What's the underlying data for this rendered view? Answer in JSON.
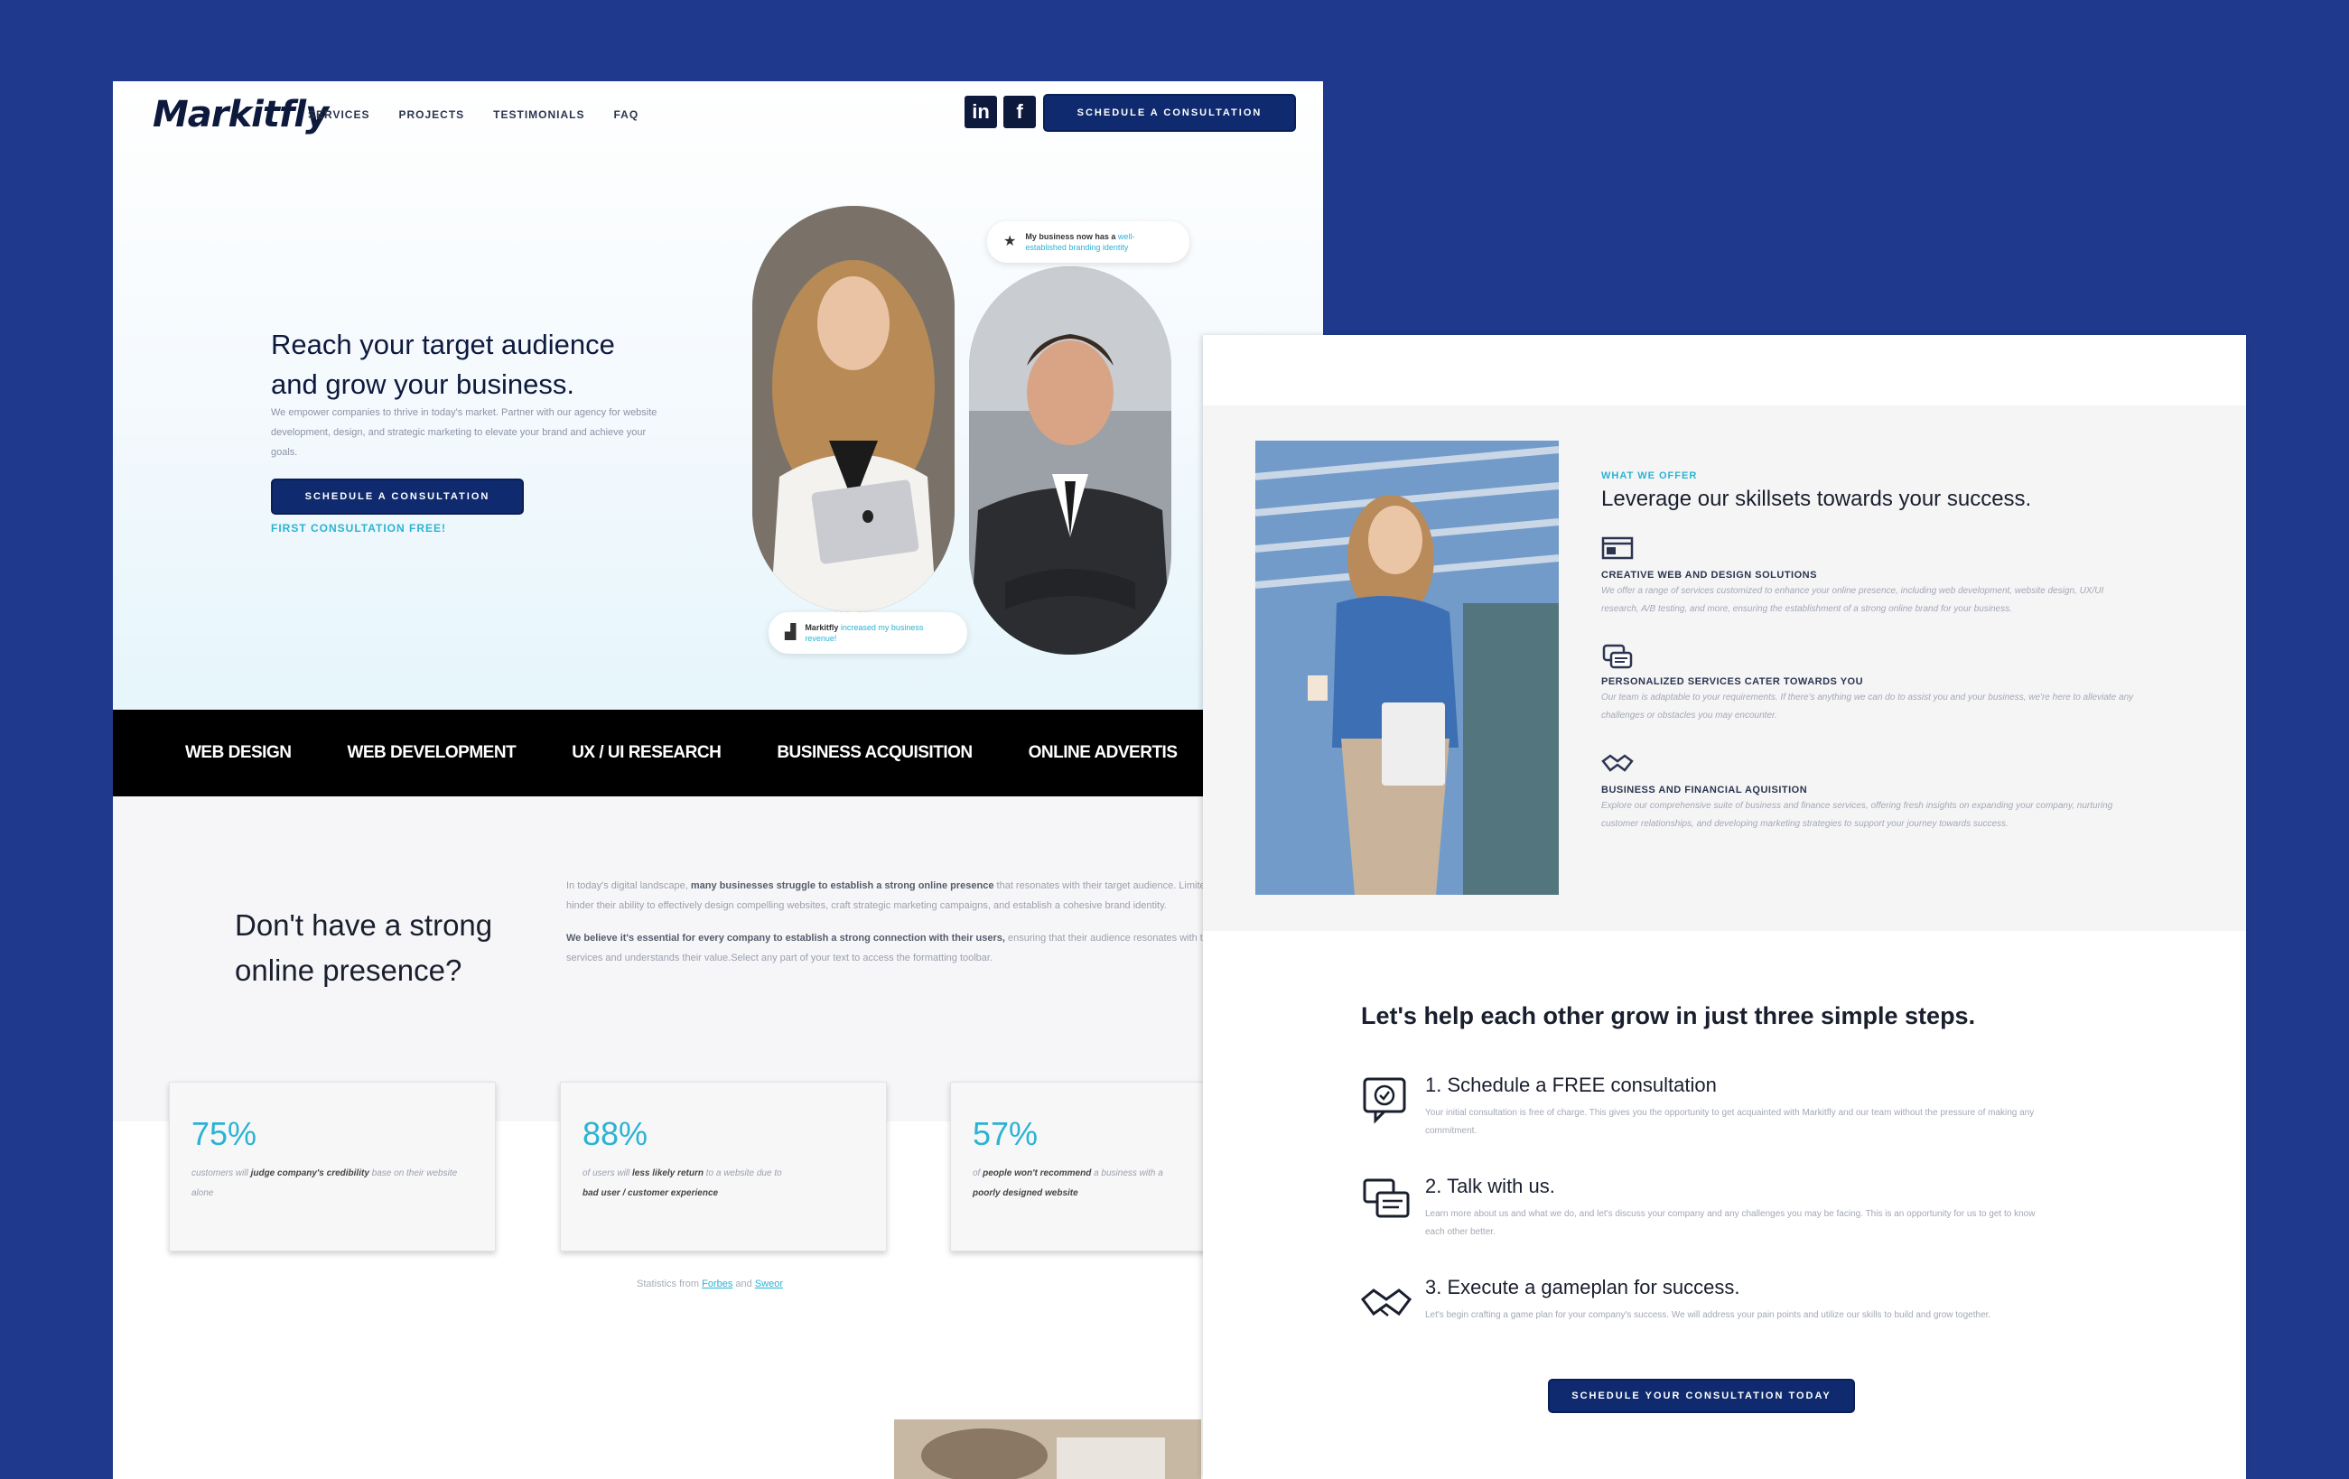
{
  "colors": {
    "background": "#1f3a8c",
    "navy": "#0f2a6e",
    "accent": "#2bb3d3",
    "bar": "#000000"
  },
  "left_page": {
    "logo": "Markitfly",
    "nav": [
      "SERVICES",
      "PROJECTS",
      "TESTIMONIALS",
      "FAQ"
    ],
    "social": {
      "linkedin": "in",
      "facebook": "f"
    },
    "cta_label": "SCHEDULE A CONSULTATION",
    "hero": {
      "title_line1": "Reach your target audience",
      "title_line2": "and grow your business.",
      "subtitle": "We empower companies to thrive in today's market. Partner with our agency for website development, design, and strategic marketing to elevate your brand and achieve your goals.",
      "button": "SCHEDULE A CONSULTATION",
      "free_note": "FIRST CONSULTATION FREE!"
    },
    "badge_top": {
      "lead": "My business now has a",
      "highlight": "well-established branding identity"
    },
    "badge_bottom": {
      "lead": "Markitfly",
      "highlight": "increased my business revenue!"
    },
    "services": [
      "WEB DESIGN",
      "WEB DEVELOPMENT",
      "UX / UI RESEARCH",
      "BUSINESS ACQUISITION",
      "ONLINE ADVERTIS"
    ],
    "question": {
      "line1": "Don't have a strong",
      "line2": "online presence?",
      "p1_a": "In today's digital landscape, ",
      "p1_b": "many businesses struggle to establish a strong online presence",
      "p1_c": " that resonates with their target audience. Limited resources and expertise often hinder their ability to effectively design compelling websites, craft strategic marketing campaigns, and establish a cohesive brand identity.",
      "p2_a": "We believe it's essential for every company to establish a strong connection with their users,",
      "p2_b": " ensuring that their audience resonates with the benefits of their products or services and understands their value.Select any part of your text to access the formatting toolbar."
    },
    "stats": [
      {
        "value": "75%",
        "pre": "customers will ",
        "bold": "judge company's credibility",
        "post": " base on their website alone"
      },
      {
        "value": "88%",
        "pre": "of users will ",
        "bold": "less likely return",
        "post": " to a website due to",
        "bold2": "bad user / customer experience"
      },
      {
        "value": "57%",
        "pre": "of ",
        "bold": "people won't recommend",
        "post": " a business with a",
        "bold2": "poorly designed website"
      }
    ],
    "source": {
      "pre": "Statistics from ",
      "link1": "Forbes",
      "mid": " and ",
      "link2": "Sweor"
    }
  },
  "right_page": {
    "kicker": "WHAT WE OFFER",
    "title": "Leverage our skillsets towards your success.",
    "services": [
      {
        "title": "CREATIVE WEB AND DESIGN SOLUTIONS",
        "desc": "We offer a range of services customized to enhance your online presence, including web development, website design, UX/UI research, A/B testing, and more, ensuring the establishment of a strong online brand for your business."
      },
      {
        "title": "PERSONALIZED SERVICES CATER TOWARDS YOU",
        "desc": "Our team is adaptable to your requirements. If there's anything we can do to assist you and your business, we're here to alleviate any challenges or obstacles you may encounter."
      },
      {
        "title": "BUSINESS AND FINANCIAL AQUISITION",
        "desc": "Explore our comprehensive suite of business and finance services, offering fresh insights on expanding your company, nurturing customer relationships, and developing marketing strategies to support your journey towards success."
      }
    ],
    "steps_title": "Let's help each other grow in just three simple steps.",
    "steps": [
      {
        "title": "1. Schedule a FREE consultation",
        "desc": "Your initial consultation is free of charge. This gives you the opportunity to get acquainted with Markitfly and our team without the pressure of making any commitment."
      },
      {
        "title": "2. Talk with us.",
        "desc": "Learn more about us and what we do, and let's discuss your company and any challenges you may be facing. This is an opportunity for us to get to know each other better."
      },
      {
        "title": "3. Execute a gameplan for success.",
        "desc": "Let's begin crafting a game plan for your company's success. We will address your pain points and utilize our skills to build and grow together."
      }
    ],
    "cta": "SCHEDULE YOUR CONSULTATION TODAY"
  }
}
